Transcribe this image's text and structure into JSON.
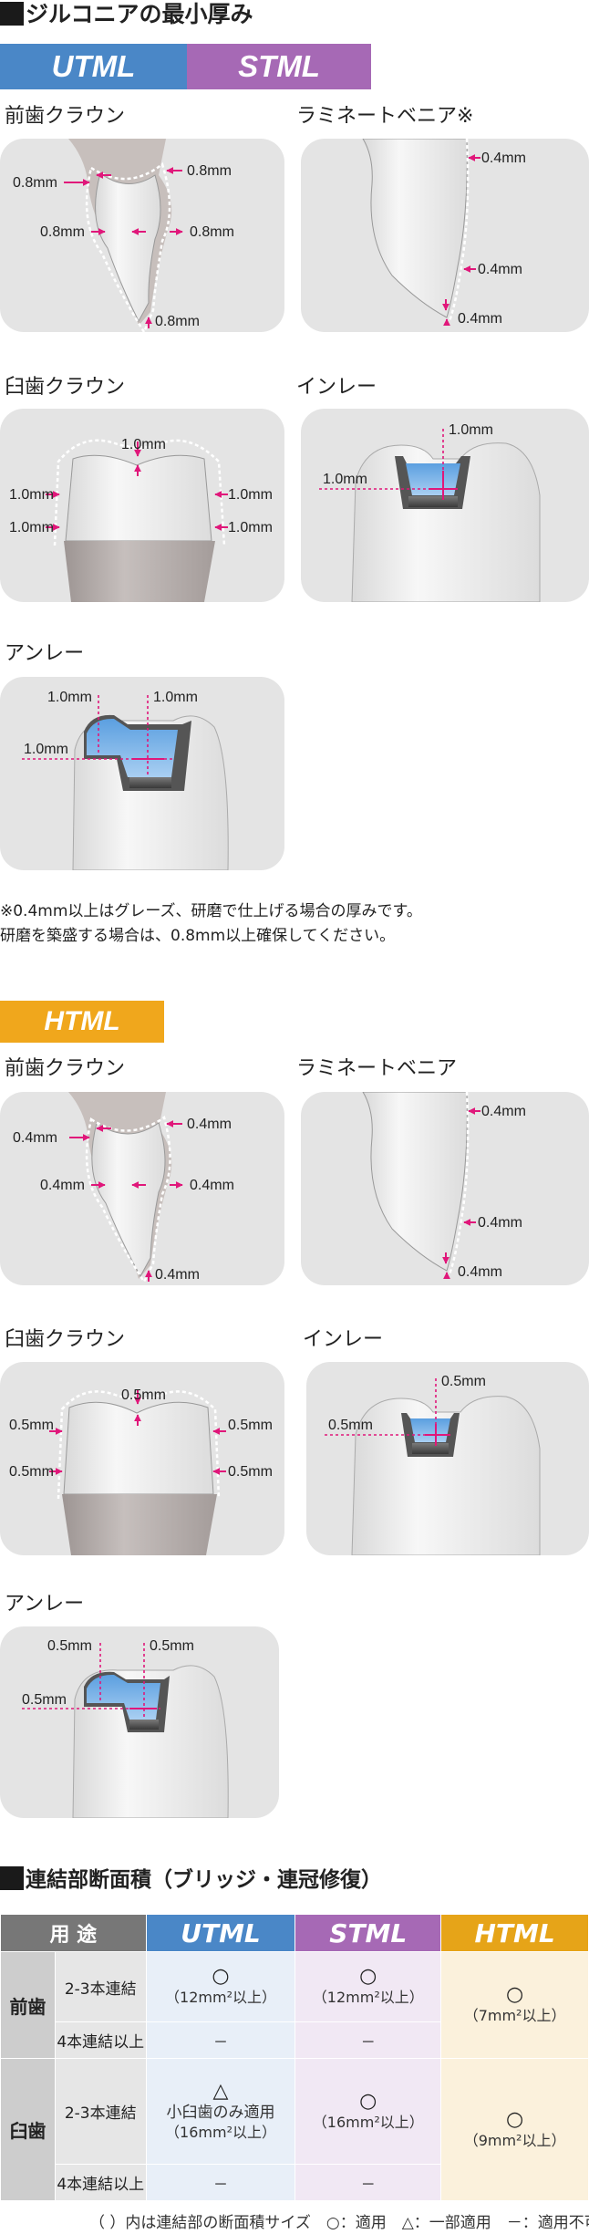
{
  "section1": {
    "title": "ジルコニアの最小厚み",
    "banners": [
      "UTML",
      "STML"
    ],
    "panels": {
      "anterior_crown": {
        "label": "前歯クラウン",
        "m1": "0.8mm",
        "m2": "0.8mm",
        "m3": "0.8mm",
        "m4": "0.8mm",
        "m5": "0.8mm"
      },
      "veneer": {
        "label": "ラミネートベニア※",
        "m1": "0.4mm",
        "m2": "0.4mm",
        "m3": "0.4mm"
      },
      "molar_crown": {
        "label": "臼歯クラウン",
        "m1": "1.0mm",
        "m2": "1.0mm",
        "m3": "1.0mm",
        "m4": "1.0mm",
        "m5": "1.0mm"
      },
      "inlay": {
        "label": "インレー",
        "m1": "1.0mm",
        "m2": "1.0mm"
      },
      "onlay": {
        "label": "アンレー",
        "m1": "1.0mm",
        "m2": "1.0mm",
        "m3": "1.0mm"
      }
    },
    "note_line1": "※0.4mm以上はグレーズ、研磨で仕上げる場合の厚みです。",
    "note_line2": "研磨を築盛する場合は、0.8mm以上確保してください。"
  },
  "section2": {
    "banner": "HTML",
    "panels": {
      "anterior_crown": {
        "label": "前歯クラウン",
        "m1": "0.4mm",
        "m2": "0.4mm",
        "m3": "0.4mm",
        "m4": "0.4mm",
        "m5": "0.4mm"
      },
      "veneer": {
        "label": "ラミネートベニア",
        "m1": "0.4mm",
        "m2": "0.4mm",
        "m3": "0.4mm"
      },
      "molar_crown": {
        "label": "臼歯クラウン",
        "m1": "0.5mm",
        "m2": "0.5mm",
        "m3": "0.5mm",
        "m4": "0.5mm",
        "m5": "0.5mm"
      },
      "inlay": {
        "label": "インレー",
        "m1": "0.5mm",
        "m2": "0.5mm"
      },
      "onlay": {
        "label": "アンレー",
        "m1": "0.5mm",
        "m2": "0.5mm",
        "m3": "0.5mm"
      }
    }
  },
  "section3": {
    "title": "連結部断面積（ブリッジ・連冠修復）",
    "headers": {
      "use": "用 途",
      "utml": "UTML",
      "stml": "STML",
      "html": "HTML"
    },
    "rows": {
      "anterior": "前歯",
      "posterior": "臼歯",
      "sub_23": "2-3本連結",
      "sub_4": "4本連結以上"
    },
    "cells": {
      "ant_23_u_sym": "○",
      "ant_23_u_cap": "（12mm²以上）",
      "ant_23_s_sym": "○",
      "ant_23_s_cap": "（12mm²以上）",
      "ant_h_sym": "○",
      "ant_h_cap": "（7mm²以上）",
      "ant_4_u": "－",
      "ant_4_s": "－",
      "pos_23_u_sym": "△",
      "pos_23_u_cap1": "小臼歯のみ適用",
      "pos_23_u_cap2": "（16mm²以上）",
      "pos_23_s_sym": "○",
      "pos_23_s_cap": "（16mm²以上）",
      "pos_h_sym": "○",
      "pos_h_cap": "（9mm²以上）",
      "pos_4_u": "－",
      "pos_4_s": "－"
    },
    "legend": "（ ）内は連結部の断面積サイズ　○：適用　△：一部適用　－：適用不可"
  },
  "colors": {
    "utml": "#4a87c7",
    "stml": "#a669b5",
    "html": "#f0a71c",
    "arrow": "#e0177a"
  }
}
